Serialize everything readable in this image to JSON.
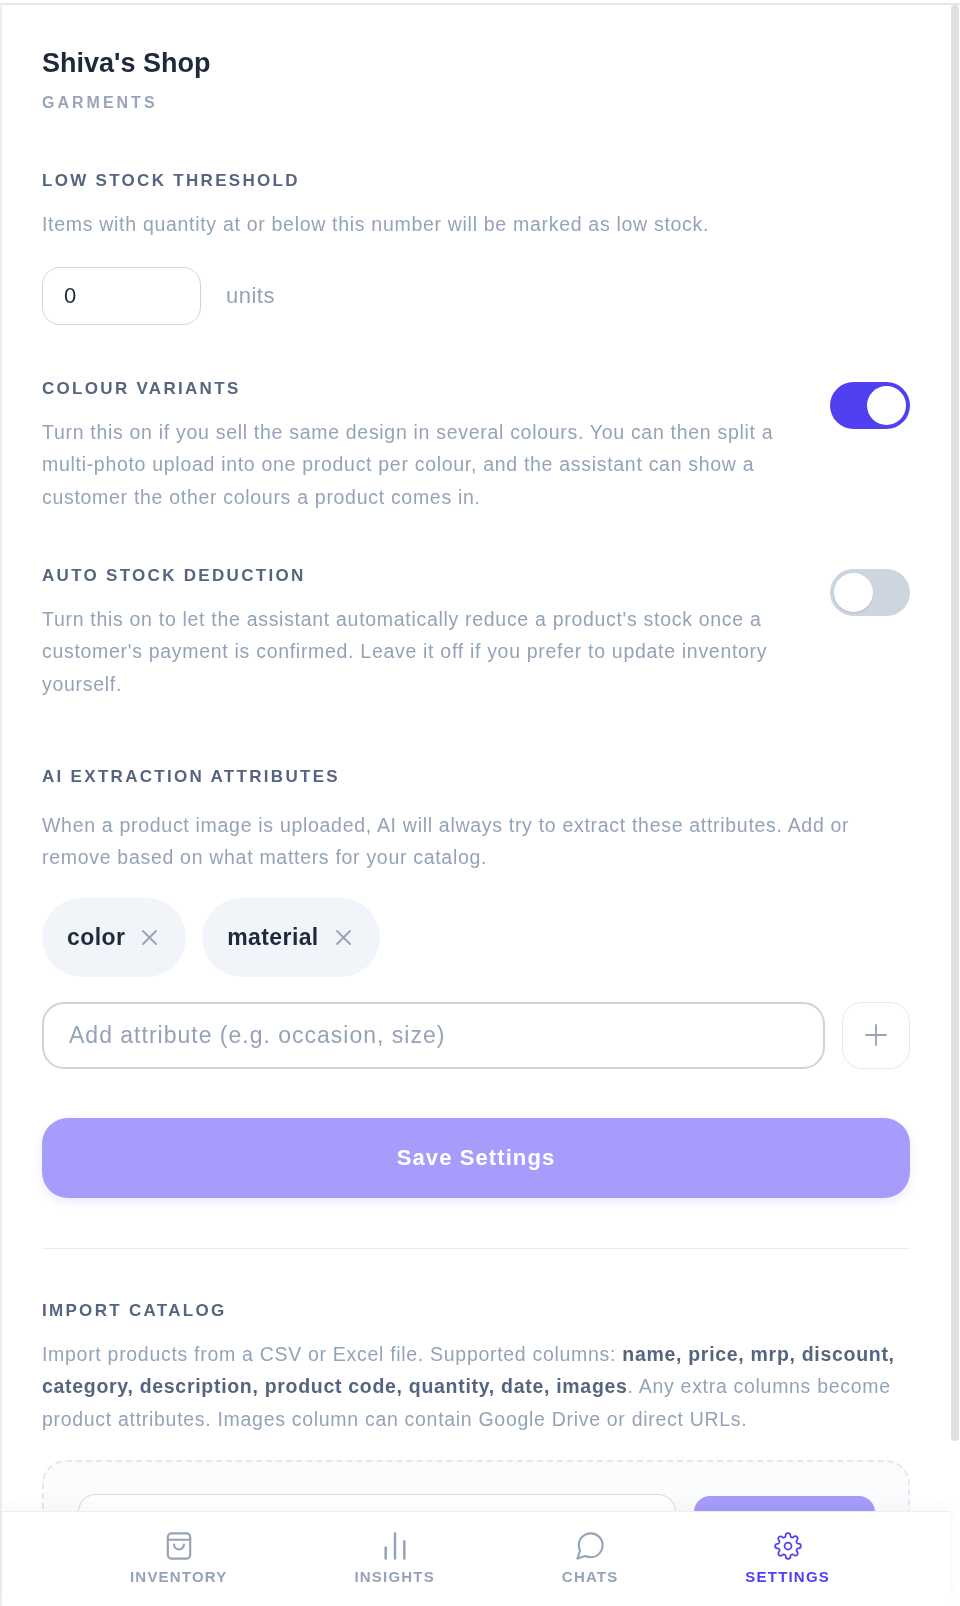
{
  "shop": {
    "name": "Shiva's Shop",
    "category": "GARMENTS"
  },
  "low_stock": {
    "heading": "LOW STOCK THRESHOLD",
    "description": "Items with quantity at or below this number will be marked as low stock.",
    "value": "0",
    "unit": "units"
  },
  "toggles": [
    {
      "heading": "COLOUR VARIANTS",
      "description": "Turn this on if you sell the same design in several colours. You can then split a multi-photo upload into one product per colour, and the assistant can show a customer the other colours a product comes in.",
      "on": true
    },
    {
      "heading": "AUTO STOCK DEDUCTION",
      "description": "Turn this on to let the assistant automatically reduce a product's stock once a customer's payment is confirmed. Leave it off if you prefer to update inventory yourself.",
      "on": false
    }
  ],
  "ai_attributes": {
    "heading": "AI EXTRACTION ATTRIBUTES",
    "description": "When a product image is uploaded, AI will always try to extract these attributes. Add or remove based on what matters for your catalog.",
    "tags": [
      "color",
      "material"
    ],
    "input": {
      "placeholder": "Add attribute (e.g. occasion, size)"
    }
  },
  "save_button": {
    "label": "Save Settings",
    "disabled": true
  },
  "import_catalog": {
    "heading": "IMPORT CATALOG",
    "description": "Import products from a CSV or Excel file. Supported columns: **name, price, mrp, discount, category, description, product code, quantity, date, images**. Any extra columns become product attributes. Images column can contain Google Drive or direct URLs."
  },
  "bottom_nav": [
    {
      "label": "INVENTORY",
      "selected": false
    },
    {
      "label": "INSIGHTS",
      "selected": false
    },
    {
      "label": "CHATS",
      "selected": false
    },
    {
      "label": "SETTINGS",
      "selected": true
    }
  ]
}
